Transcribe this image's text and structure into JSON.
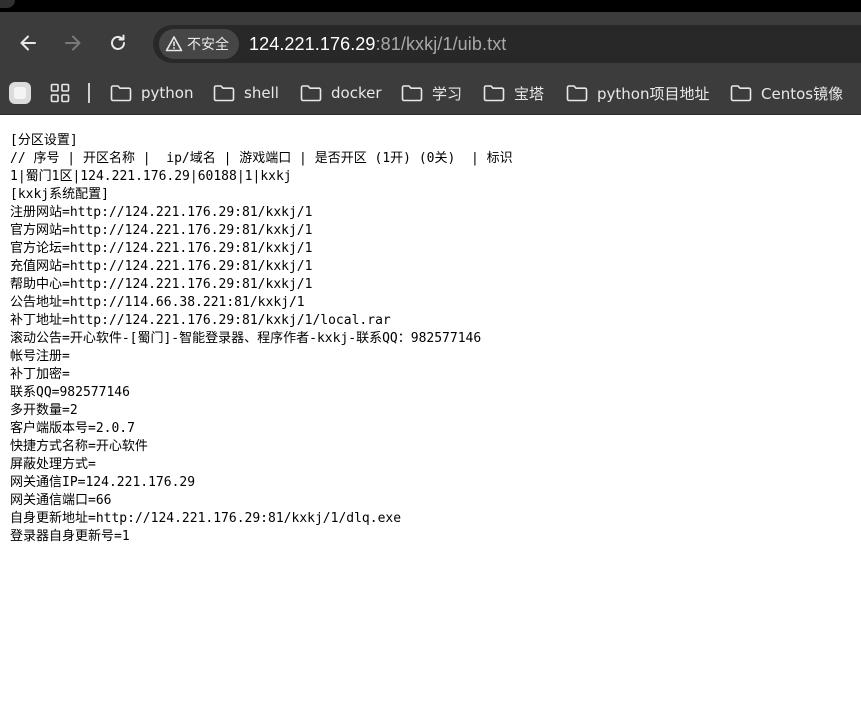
{
  "browser": {
    "security_chip": {
      "label": "不安全",
      "icon": "warning-triangle-icon"
    },
    "url": {
      "host": "124.221.176.29",
      "rest": ":81/kxkj/1/uib.txt"
    },
    "nav": {
      "back_icon": "back-arrow-icon",
      "forward_icon": "forward-arrow-icon",
      "reload_icon": "reload-icon"
    }
  },
  "bookmarks": [
    {
      "label": "python"
    },
    {
      "label": "shell"
    },
    {
      "label": "docker"
    },
    {
      "label": "学习"
    },
    {
      "label": "宝塔"
    },
    {
      "label": "python项目地址"
    },
    {
      "label": "Centos镜像"
    }
  ],
  "document": {
    "lines": [
      "[分区设置]",
      "// 序号 | 开区名称 |  ip/域名 | 游戏端口 | 是否开区 (1开) (0关)  | 标识",
      "1|蜀门1区|124.221.176.29|60188|1|kxkj",
      "[kxkj系统配置]",
      "注册网站=http://124.221.176.29:81/kxkj/1",
      "官方网站=http://124.221.176.29:81/kxkj/1",
      "官方论坛=http://124.221.176.29:81/kxkj/1",
      "充值网站=http://124.221.176.29:81/kxkj/1",
      "帮助中心=http://124.221.176.29:81/kxkj/1",
      "公告地址=http://114.66.38.221:81/kxkj/1",
      "补丁地址=http://124.221.176.29:81/kxkj/1/local.rar",
      "滚动公告=开心软件-[蜀门]-智能登录器、程序作者-kxkj-联系QQ：982577146",
      "帐号注册=",
      "补丁加密=",
      "联系QQ=982577146",
      "多开数量=2",
      "客户端版本号=2.0.7",
      "快捷方式名称=开心软件",
      "屏蔽处理方式=",
      "网关通信IP=124.221.176.29",
      "网关通信端口=66",
      "自身更新地址=http://124.221.176.29:81/kxkj/1/dlq.exe",
      "登录器自身更新号=1"
    ]
  },
  "colors": {
    "toolbar_bg": "#3c3c3c",
    "omnibox_bg": "#282828",
    "page_bg": "#ffffff",
    "text": "#000000"
  }
}
